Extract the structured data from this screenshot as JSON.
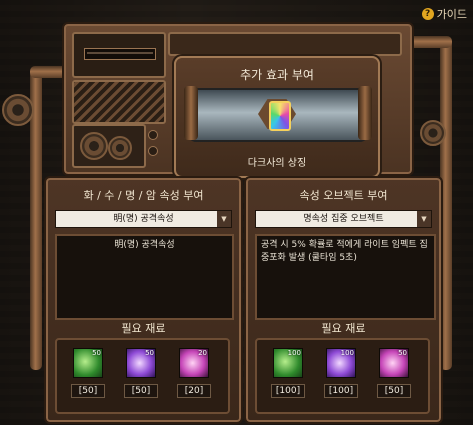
{
  "guide": {
    "label": "가이드"
  },
  "effect": {
    "title": "추가 효과 부여",
    "emblem_name": "다크사의 상징"
  },
  "left_panel": {
    "title": "화 / 수 / 명 / 암 속성 부여",
    "selected": "明(명) 공격속성",
    "description": "明(명) 공격속성",
    "materials_title": "필요 재료",
    "materials": [
      {
        "icon": "green-crystal-icon",
        "badge": "50",
        "count": "50"
      },
      {
        "icon": "purple-swirl-icon",
        "badge": "50",
        "count": "50"
      },
      {
        "icon": "magenta-burst-icon",
        "badge": "20",
        "count": "20"
      }
    ]
  },
  "right_panel": {
    "title": "속성 오브젝트 부여",
    "selected": "명속성 집중 오브젝트",
    "description": "공격 시 5% 확률로 적에게 라이트 임펙트 집중포화 발생 (쿨타임 5초)",
    "materials_title": "필요 재료",
    "materials": [
      {
        "icon": "green-crystal-icon",
        "badge": "100",
        "count": "100"
      },
      {
        "icon": "purple-swirl-icon",
        "badge": "100",
        "count": "100"
      },
      {
        "icon": "magenta-burst-icon",
        "badge": "50",
        "count": "50"
      }
    ]
  }
}
